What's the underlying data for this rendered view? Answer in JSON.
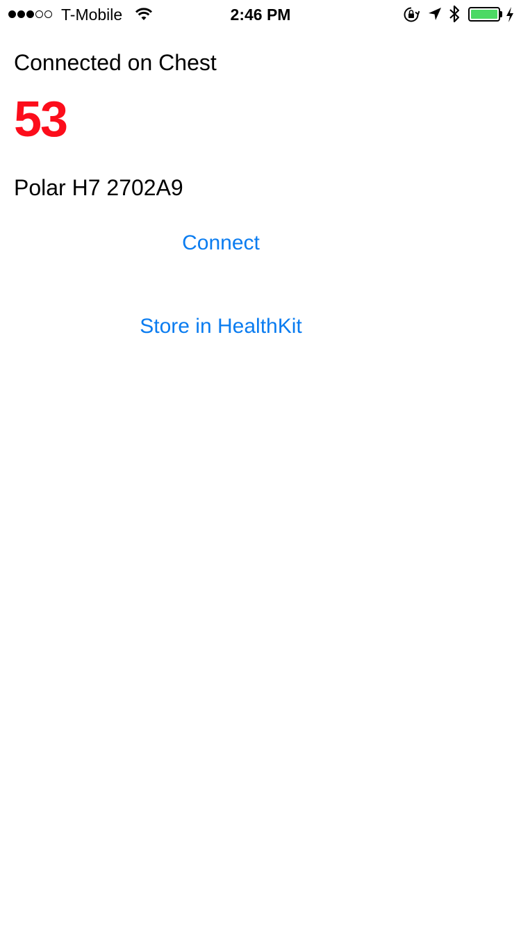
{
  "status_bar": {
    "signal_bars_filled": 3,
    "signal_bars_total": 5,
    "carrier": "T-Mobile",
    "time": "2:46 PM",
    "icons": [
      "wifi-icon",
      "orientation-lock-icon",
      "location-arrow-icon",
      "bluetooth-icon",
      "battery-icon",
      "charging-icon"
    ],
    "battery_level": 1.0,
    "battery_color": "#4cd964"
  },
  "main": {
    "connection_status": "Connected on Chest",
    "heart_rate": "53",
    "heart_rate_color": "#fc0d1b",
    "device_name": "Polar H7 2702A9",
    "connect_label": "Connect",
    "store_label": "Store in HealthKit",
    "link_color": "#0a7cf0"
  }
}
